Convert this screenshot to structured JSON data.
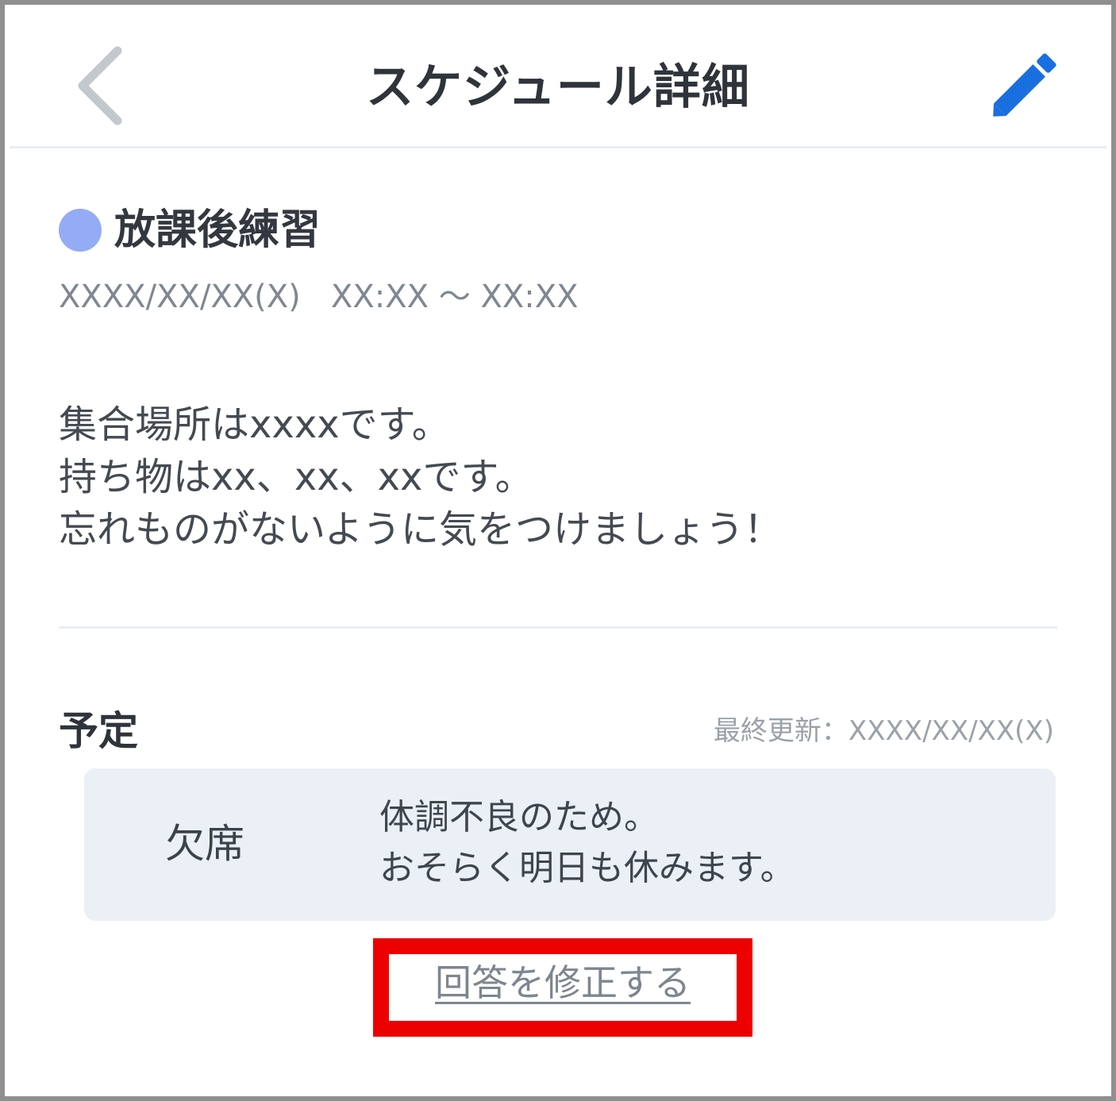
{
  "header": {
    "title": "スケジュール詳細",
    "back_icon": "chevron-left-icon",
    "edit_icon": "pencil-icon"
  },
  "event": {
    "title": "放課後練習",
    "category_color": "#94acf6",
    "datetime": "XXXX/XX/XX(X)   XX:XX ～ XX:XX",
    "description_lines": [
      "集合場所はxxxxです。",
      "持ち物はxx、xx、xxです。",
      "忘れものがないように気をつけましょう！"
    ]
  },
  "schedule": {
    "section_title": "予定",
    "last_updated": "最終更新：XXXX/XX/XX(X)",
    "response": {
      "status": "欠席",
      "comment_lines": [
        "体調不良のため。",
        "おそらく明日も休みます。"
      ]
    },
    "edit_answer_label": "回答を修正する"
  },
  "colors": {
    "accent": "#1a6fe0",
    "highlight": "#ec0000",
    "card_background": "#ebf0f7"
  }
}
